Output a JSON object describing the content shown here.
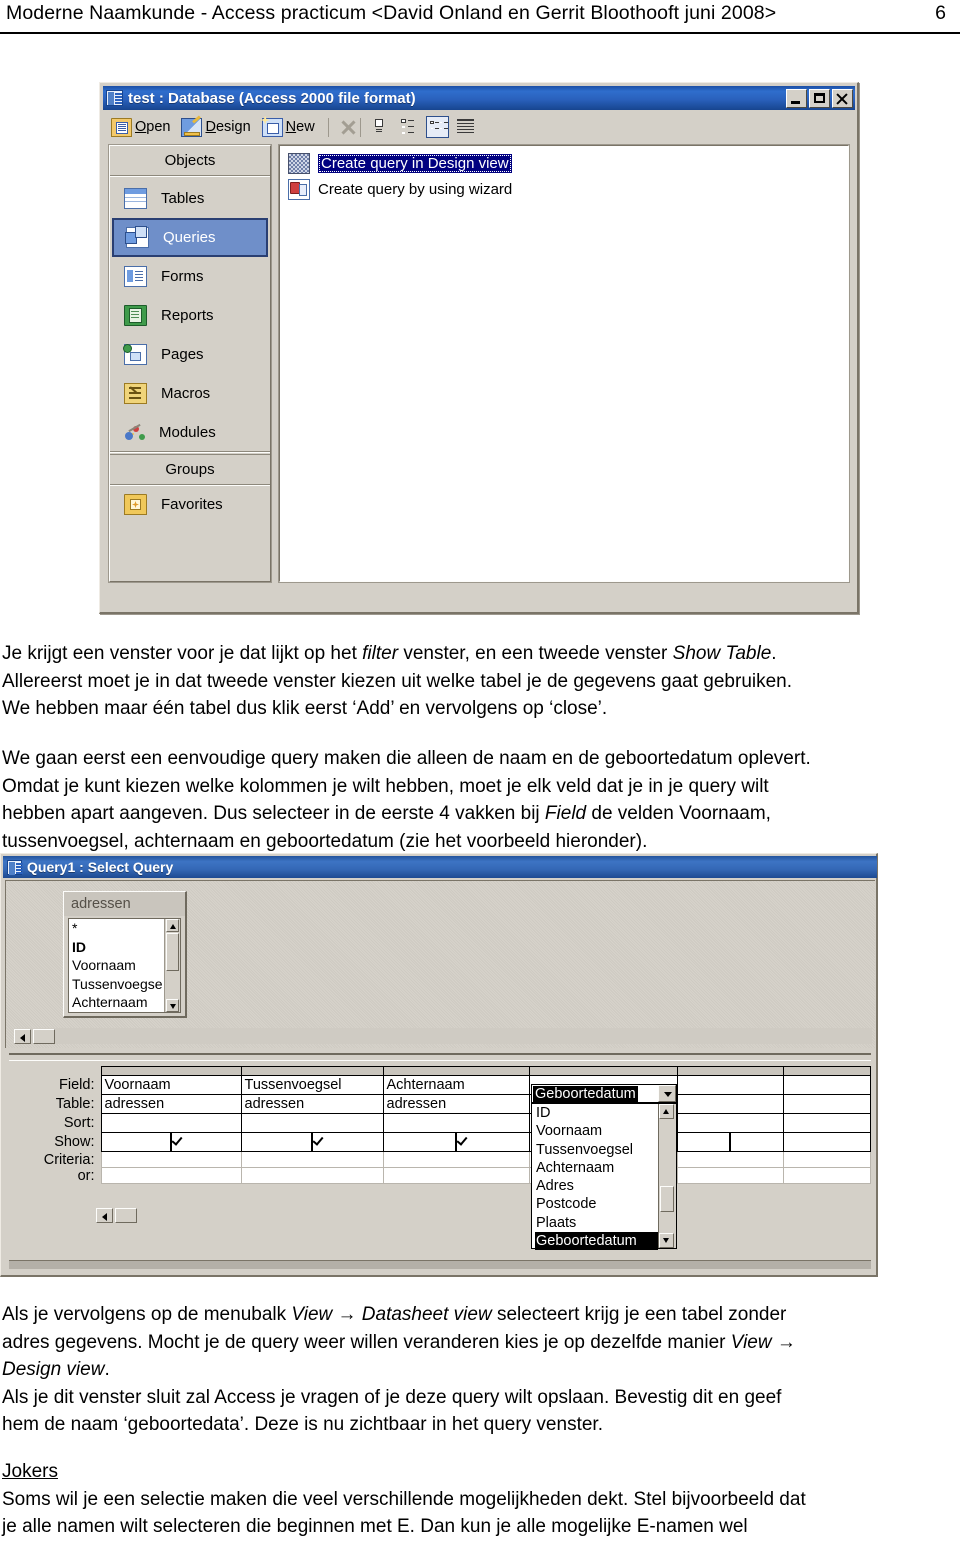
{
  "page_header": {
    "title": "Moderne Naamkunde  -  Access practicum  <David Onland en Gerrit Bloothooft juni 2008>",
    "page_number": "6"
  },
  "database_window": {
    "title": "test : Database (Access 2000 file format)",
    "window_buttons": {
      "minimize": "minimize-icon",
      "maximize": "maximize-icon",
      "close": "close-icon"
    },
    "toolbar": {
      "open_label": "Open",
      "design_label": "Design",
      "new_label": "New",
      "delete_icon": "delete-x-icon",
      "view_large_icons": "large-icons-view-icon",
      "view_small_icons": "small-icons-view-icon",
      "view_list": "list-view-icon",
      "view_details": "details-view-icon"
    },
    "objects_header": "Objects",
    "objects": [
      {
        "label": "Tables",
        "icon": "tables-icon",
        "selected": false
      },
      {
        "label": "Queries",
        "icon": "queries-icon",
        "selected": true
      },
      {
        "label": "Forms",
        "icon": "forms-icon",
        "selected": false
      },
      {
        "label": "Reports",
        "icon": "reports-icon",
        "selected": false
      },
      {
        "label": "Pages",
        "icon": "pages-icon",
        "selected": false
      },
      {
        "label": "Macros",
        "icon": "macros-icon",
        "selected": false
      },
      {
        "label": "Modules",
        "icon": "modules-icon",
        "selected": false
      }
    ],
    "groups_header": "Groups",
    "groups": [
      {
        "label": "Favorites",
        "icon": "favorites-folder-icon"
      }
    ],
    "query_list": [
      {
        "label": "Create query in Design view",
        "icon": "design-grid-icon",
        "selected": true
      },
      {
        "label": "Create query by using wizard",
        "icon": "query-wizard-icon",
        "selected": false
      }
    ]
  },
  "body": {
    "para1_line1_a": "Je krijgt een venster voor je dat lijkt op het ",
    "para1_line1_i1": "filter",
    "para1_line1_b": " venster, en een tweede venster ",
    "para1_line1_i2": "Show Table",
    "para1_line1_c": ".",
    "para1_line2": "Allereerst moet je in dat tweede venster kiezen uit welke tabel je de gegevens gaat gebruiken.",
    "para1_line3": "We hebben maar één tabel dus klik eerst ‘Add’ en vervolgens op ‘close’.",
    "para2_line1": "We gaan eerst een eenvoudige query maken die alleen de naam en de geboortedatum oplevert.",
    "para2_line2": "Omdat je kunt kiezen welke kolommen je wilt hebben, moet je elk veld dat je in je query wilt",
    "para2_line3_a": "hebben apart aangeven. Dus selecteer in de eerste 4 vakken bij ",
    "para2_line3_i": "Field",
    "para2_line3_b": " de velden Voornaam,",
    "para2_line4": "tussenvoegsel, achternaam en geboortedatum (zie het voorbeeld hieronder).",
    "para3_line1_a": "Als je vervolgens op de menubalk ",
    "para3_line1_i1": "View → Datasheet view",
    "para3_line1_b": " selecteert krijg je een tabel zonder",
    "para3_line2_a": "adres gegevens. Mocht je de query weer willen veranderen kies je op dezelfde manier ",
    "para3_line2_i": "View →",
    "para3_line3_i": "Design view",
    "para3_line3_b": ".",
    "para3_line4": "Als je dit venster sluit zal Access je vragen of je deze query wilt opslaan. Bevestig dit en geef",
    "para3_line5": "hem de naam ‘geboortedata’. Deze is nu zichtbaar in het query venster.",
    "jokers_heading": "Jokers",
    "para4_line1": "Soms wil je een selectie maken die veel verschillende mogelijkheden dekt. Stel bijvoorbeeld dat",
    "para4_line2": "je alle namen wilt selecteren die beginnen met E. Dan kun je alle mogelijke E-namen wel"
  },
  "query_window": {
    "title": "Query1 : Select Query",
    "table_box": {
      "caption": "adressen",
      "fields": [
        "*",
        "ID",
        "Voornaam",
        "Tussenvoegse",
        "Achternaam"
      ],
      "bold_field": "ID"
    },
    "grid": {
      "row_labels": [
        "Field:",
        "Table:",
        "Sort:",
        "Show:",
        "Criteria:",
        "or:"
      ],
      "columns": [
        {
          "field": "Voornaam",
          "table": "adressen",
          "sort": "",
          "show": true,
          "criteria": "",
          "or": ""
        },
        {
          "field": "Tussenvoegsel",
          "table": "adressen",
          "sort": "",
          "show": true,
          "criteria": "",
          "or": ""
        },
        {
          "field": "Achternaam",
          "table": "adressen",
          "sort": "",
          "show": true,
          "criteria": "",
          "or": ""
        },
        {
          "field": "Geboortedatum",
          "table": "",
          "sort": "",
          "show": false,
          "criteria": "",
          "or": ""
        },
        {
          "field": "",
          "table": "",
          "sort": "",
          "show": false,
          "criteria": "",
          "or": ""
        },
        {
          "field": "",
          "table": "",
          "sort": "",
          "show": false,
          "criteria": "",
          "or": ""
        }
      ]
    },
    "dropdown": {
      "selected_value": "Geboortedatum",
      "options": [
        "ID",
        "Voornaam",
        "Tussenvoegsel",
        "Achternaam",
        "Adres",
        "Postcode",
        "Plaats",
        "Geboortedatum"
      ],
      "highlighted_option": "Geboortedatum"
    }
  },
  "colors": {
    "titlebar_blue": "#2a61bd",
    "selection_navy": "#000080",
    "window_face": "#d4d0c8",
    "sidebar_selected": "#6f8fc9"
  }
}
